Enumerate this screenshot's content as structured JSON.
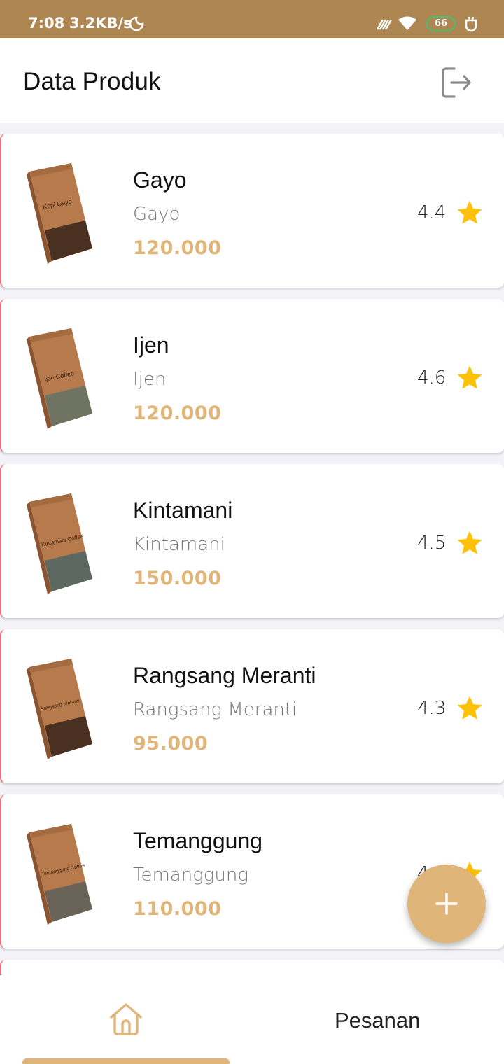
{
  "status_bar": {
    "time": "7:08",
    "speed": "3.2KB/s",
    "battery": "66"
  },
  "app_bar": {
    "title": "Data Produk",
    "logout_icon": "logout-icon"
  },
  "products": [
    {
      "name": "Gayo",
      "subtitle": "Gayo",
      "price": "120.000",
      "rating": "4.4",
      "label": "Kopi Gayo"
    },
    {
      "name": "Ijen",
      "subtitle": "Ijen",
      "price": "120.000",
      "rating": "4.6",
      "label": "Ijen Coffee"
    },
    {
      "name": "Kintamani",
      "subtitle": "Kintamani",
      "price": "150.000",
      "rating": "4.5",
      "label": "Kintamani Coffee"
    },
    {
      "name": "Rangsang Meranti",
      "subtitle": "Rangsang Meranti",
      "price": "95.000",
      "rating": "4.3",
      "label": "Rangsang Meranti"
    },
    {
      "name": "Temanggung",
      "subtitle": "Temanggung",
      "price": "110.000",
      "rating": "4.",
      "label": "Temanggung Coffee"
    }
  ],
  "fab": {
    "icon": "plus-icon"
  },
  "bottom_nav": {
    "home_icon": "home-icon",
    "orders_label": "Pesanan"
  },
  "colors": {
    "status_bar": "#ad8652",
    "accent": "#e0b57a",
    "star": "#ffc107",
    "battery": "#3fc272"
  }
}
